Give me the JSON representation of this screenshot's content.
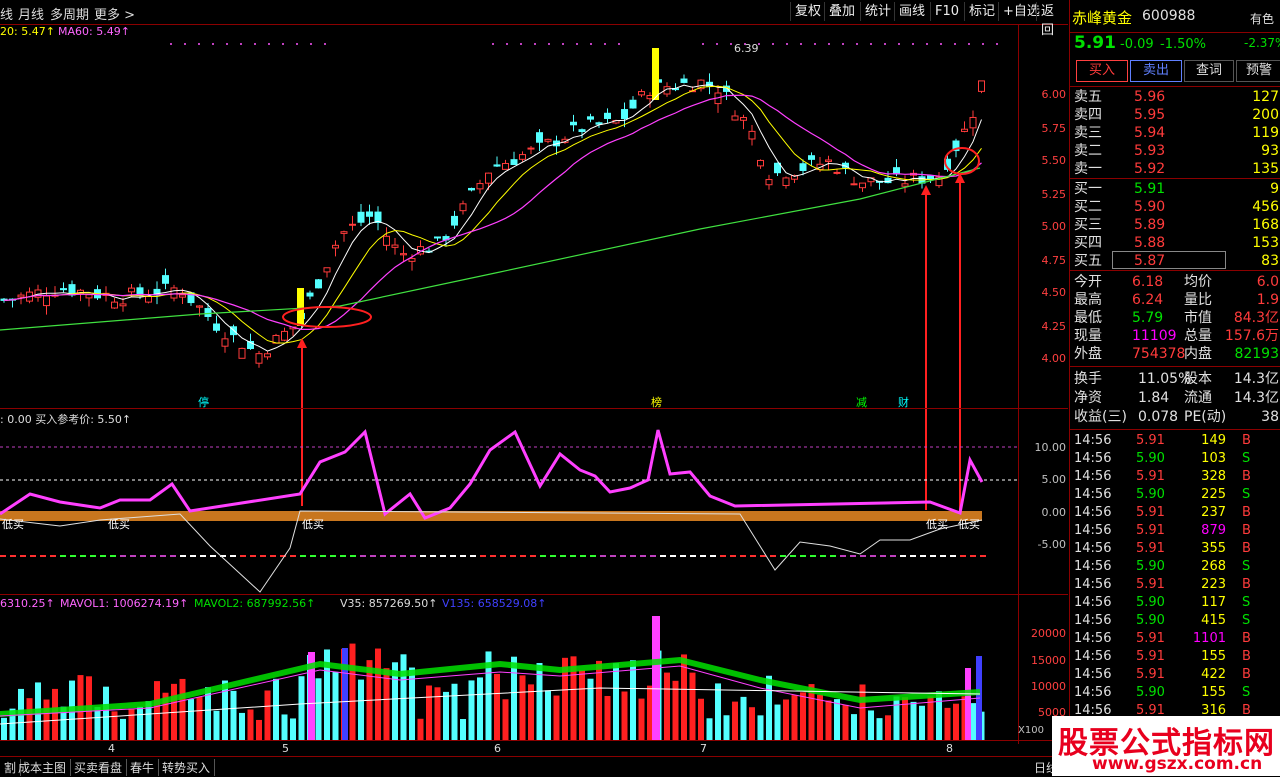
{
  "toolbar": {
    "left_items": [
      "线",
      "月线",
      "多周期",
      "更多 >"
    ],
    "right_items": [
      "复权",
      "叠加",
      "统计",
      "画线",
      "F10",
      "标记",
      "+自选",
      "返回"
    ]
  },
  "main_chart": {
    "ma_legend_1": "20: 5.47↑",
    "ma_legend_2": "MA60: 5.49↑",
    "high_label": "6.39",
    "price_ticks": [
      "6.00",
      "5.75",
      "5.50",
      "5.25",
      "5.00",
      "4.75",
      "4.50",
      "4.25",
      "4.00"
    ],
    "event_tags": [
      "停",
      "榜",
      "减",
      "财"
    ]
  },
  "indicator": {
    "legend": ": 0.00  买入参考价: 5.50↑",
    "ticks": [
      "10.00",
      "5.00",
      "0.00",
      "-5.00"
    ],
    "signal_labels": [
      "低买",
      "低买",
      "低买",
      "低买",
      "低买"
    ]
  },
  "volume": {
    "legend_1": "6310.25↑",
    "legend_2": "MAVOL1: 1006274.19↑",
    "legend_3": "MAVOL2: 687992.56↑",
    "legend_4": "V35: 857269.50↑",
    "legend_5": "V135: 658529.08↑",
    "ticks": [
      "20000",
      "15000",
      "10000",
      "5000"
    ],
    "unit": "X100",
    "month_labels": [
      "4",
      "5",
      "6",
      "7",
      "8"
    ]
  },
  "bottom_tabs": [
    "割",
    "成本主图",
    "买卖看盘",
    "春牛",
    "转势买入"
  ],
  "bottom_right": "日线",
  "quote": {
    "name": "赤峰黄金",
    "code": "600988",
    "sector": "有色",
    "sector_change": "-2.37%",
    "price": "5.91",
    "change": "-0.09",
    "change_pct": "-1.50%",
    "buttons": [
      "买入",
      "卖出",
      "查词",
      "预警"
    ],
    "asks": [
      {
        "label": "卖五",
        "price": "5.96",
        "vol": "127"
      },
      {
        "label": "卖四",
        "price": "5.95",
        "vol": "200"
      },
      {
        "label": "卖三",
        "price": "5.94",
        "vol": "119"
      },
      {
        "label": "卖二",
        "price": "5.93",
        "vol": "93"
      },
      {
        "label": "卖一",
        "price": "5.92",
        "vol": "135"
      }
    ],
    "bids": [
      {
        "label": "买一",
        "price": "5.91",
        "vol": "9"
      },
      {
        "label": "买二",
        "price": "5.90",
        "vol": "456"
      },
      {
        "label": "买三",
        "price": "5.89",
        "vol": "168"
      },
      {
        "label": "买四",
        "price": "5.88",
        "vol": "153"
      },
      {
        "label": "买五",
        "price": "5.87",
        "vol": "83"
      }
    ],
    "stats": [
      {
        "l1": "今开",
        "v1": "6.18",
        "l2": "均价",
        "v2": "6.0"
      },
      {
        "l1": "最高",
        "v1": "6.24",
        "l2": "量比",
        "v2": "1.9"
      },
      {
        "l1": "最低",
        "v1": "5.79",
        "l2": "市值",
        "v2": "84.3亿"
      },
      {
        "l1": "现量",
        "v1": "11109",
        "l2": "总量",
        "v2": "157.6万"
      },
      {
        "l1": "外盘",
        "v1": "754378",
        "l2": "内盘",
        "v2": "82193"
      }
    ],
    "fund": [
      {
        "l1": "换手",
        "v1": "11.05%",
        "l2": "股本",
        "v2": "14.3亿"
      },
      {
        "l1": "净资",
        "v1": "1.84",
        "l2": "流通",
        "v2": "14.3亿"
      },
      {
        "l1": "收益(三)",
        "v1": "0.078",
        "l2": "PE(动)",
        "v2": "38"
      }
    ],
    "ticks": [
      {
        "t": "14:56",
        "p": "5.91",
        "v": "149",
        "s": "B"
      },
      {
        "t": "14:56",
        "p": "5.90",
        "v": "103",
        "s": "S"
      },
      {
        "t": "14:56",
        "p": "5.91",
        "v": "328",
        "s": "B"
      },
      {
        "t": "14:56",
        "p": "5.90",
        "v": "225",
        "s": "S"
      },
      {
        "t": "14:56",
        "p": "5.91",
        "v": "237",
        "s": "B"
      },
      {
        "t": "14:56",
        "p": "5.91",
        "v": "879",
        "s": "B"
      },
      {
        "t": "14:56",
        "p": "5.91",
        "v": "355",
        "s": "B"
      },
      {
        "t": "14:56",
        "p": "5.90",
        "v": "268",
        "s": "S"
      },
      {
        "t": "14:56",
        "p": "5.91",
        "v": "223",
        "s": "B"
      },
      {
        "t": "14:56",
        "p": "5.90",
        "v": "117",
        "s": "S"
      },
      {
        "t": "14:56",
        "p": "5.90",
        "v": "415",
        "s": "S"
      },
      {
        "t": "14:56",
        "p": "5.91",
        "v": "1101",
        "s": "B"
      },
      {
        "t": "14:56",
        "p": "5.91",
        "v": "155",
        "s": "B"
      },
      {
        "t": "14:56",
        "p": "5.91",
        "v": "422",
        "s": "B"
      },
      {
        "t": "14:56",
        "p": "5.90",
        "v": "155",
        "s": "S"
      },
      {
        "t": "14:56",
        "p": "5.91",
        "v": "316",
        "s": "B"
      }
    ]
  },
  "watermark": {
    "line1": "股票公式指标网",
    "line2": "www.gszx.com.cn"
  }
}
